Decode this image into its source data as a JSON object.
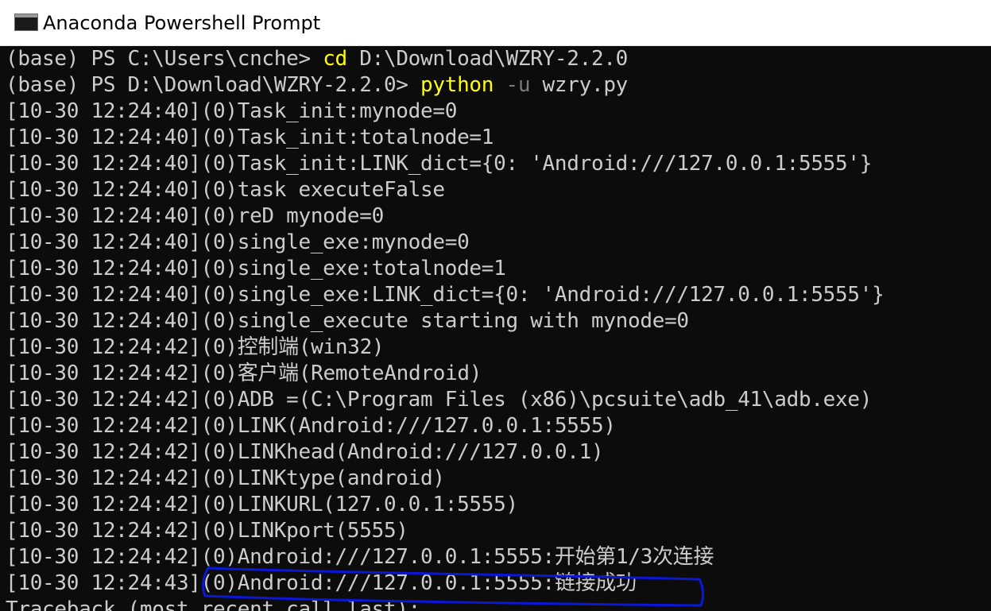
{
  "window": {
    "title": "Anaconda Powershell Prompt",
    "title_icon": "console-icon"
  },
  "console": {
    "commands": [
      {
        "prompt": "(base) PS C:\\Users\\cnche> ",
        "command": "cd",
        "flag": "",
        "args": " D:\\Download\\WZRY-2.2.0"
      },
      {
        "prompt": "(base) PS D:\\Download\\WZRY-2.2.0> ",
        "command": "python",
        "flag": " -u",
        "args": " wzry.py"
      }
    ],
    "output_lines": [
      "[10-30 12:24:40](0)Task_init:mynode=0",
      "[10-30 12:24:40](0)Task_init:totalnode=1",
      "[10-30 12:24:40](0)Task_init:LINK_dict={0: 'Android:///127.0.0.1:5555'}",
      "[10-30 12:24:40](0)task executeFalse",
      "[10-30 12:24:40](0)reD mynode=0",
      "[10-30 12:24:40](0)single_exe:mynode=0",
      "[10-30 12:24:40](0)single_exe:totalnode=1",
      "[10-30 12:24:40](0)single_exe:LINK_dict={0: 'Android:///127.0.0.1:5555'}",
      "[10-30 12:24:40](0)single_execute starting with mynode=0",
      "[10-30 12:24:42](0)控制端(win32)",
      "[10-30 12:24:42](0)客户端(RemoteAndroid)",
      "[10-30 12:24:42](0)ADB =(C:\\Program Files (x86)\\pcsuite\\adb_41\\adb.exe)",
      "[10-30 12:24:42](0)LINK(Android:///127.0.0.1:5555)",
      "[10-30 12:24:42](0)LINKhead(Android:///127.0.0.1)",
      "[10-30 12:24:42](0)LINKtype(android)",
      "[10-30 12:24:42](0)LINKURL(127.0.0.1:5555)",
      "[10-30 12:24:42](0)LINKport(5555)",
      "[10-30 12:24:42](0)Android:///127.0.0.1:5555:开始第1/3次连接",
      "[10-30 12:24:43](0)Android:///127.0.0.1:5555:链接成功",
      "Traceback (most recent call last):"
    ]
  },
  "colors": {
    "background": "#0c0c0c",
    "text": "#cccccc",
    "command": "#ffff00",
    "flag": "#7a7a7a",
    "annotation": "#0a17d6"
  }
}
